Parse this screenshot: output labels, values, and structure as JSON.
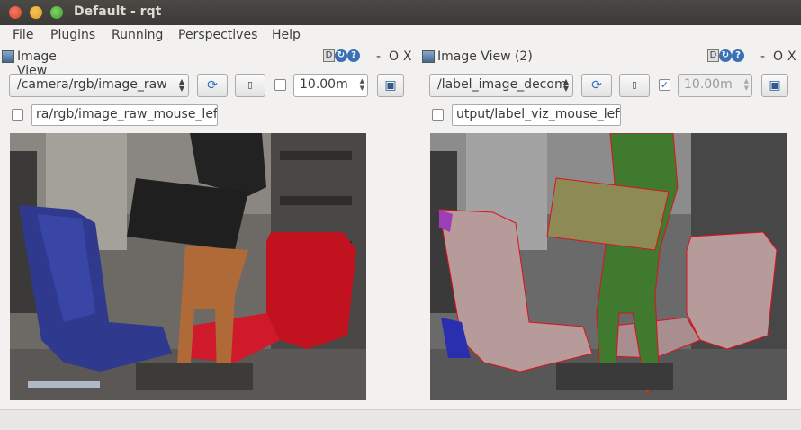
{
  "window": {
    "title": "Default - rqt"
  },
  "menu": [
    {
      "label": "File"
    },
    {
      "label": "Plugins"
    },
    {
      "label": "Running"
    },
    {
      "label": "Perspectives"
    },
    {
      "label": "Help"
    }
  ],
  "left_panel": {
    "title": "Image View",
    "topic": "/camera/rgb/image_raw",
    "zoom_value": "10.00m",
    "zoom_enabled": false,
    "mouse_topic": "ra/rgb/image_raw_mouse_left",
    "controls": {
      "d": "D",
      "help": "?",
      "minus": "-",
      "o": "O",
      "x": "X"
    }
  },
  "right_panel": {
    "title": "Image View (2)",
    "topic": "/label_image_decom",
    "zoom_value": "10.00m",
    "zoom_enabled": true,
    "mouse_topic": "utput/label_viz_mouse_left",
    "controls": {
      "d": "D",
      "help": "?",
      "minus": "-",
      "o": "O",
      "x": "X"
    }
  },
  "icons": {
    "refresh": "refresh-icon",
    "smooth": "smooth-icon",
    "save": "save-image-icon"
  },
  "colors": {
    "title_bar": "#3b3a37",
    "blue_chair": "#2f3a8e",
    "red_chair": "#c3121f",
    "label_green": "#3f7a2f",
    "label_pink": "#b79a9a",
    "label_olive": "#8d8a55"
  }
}
